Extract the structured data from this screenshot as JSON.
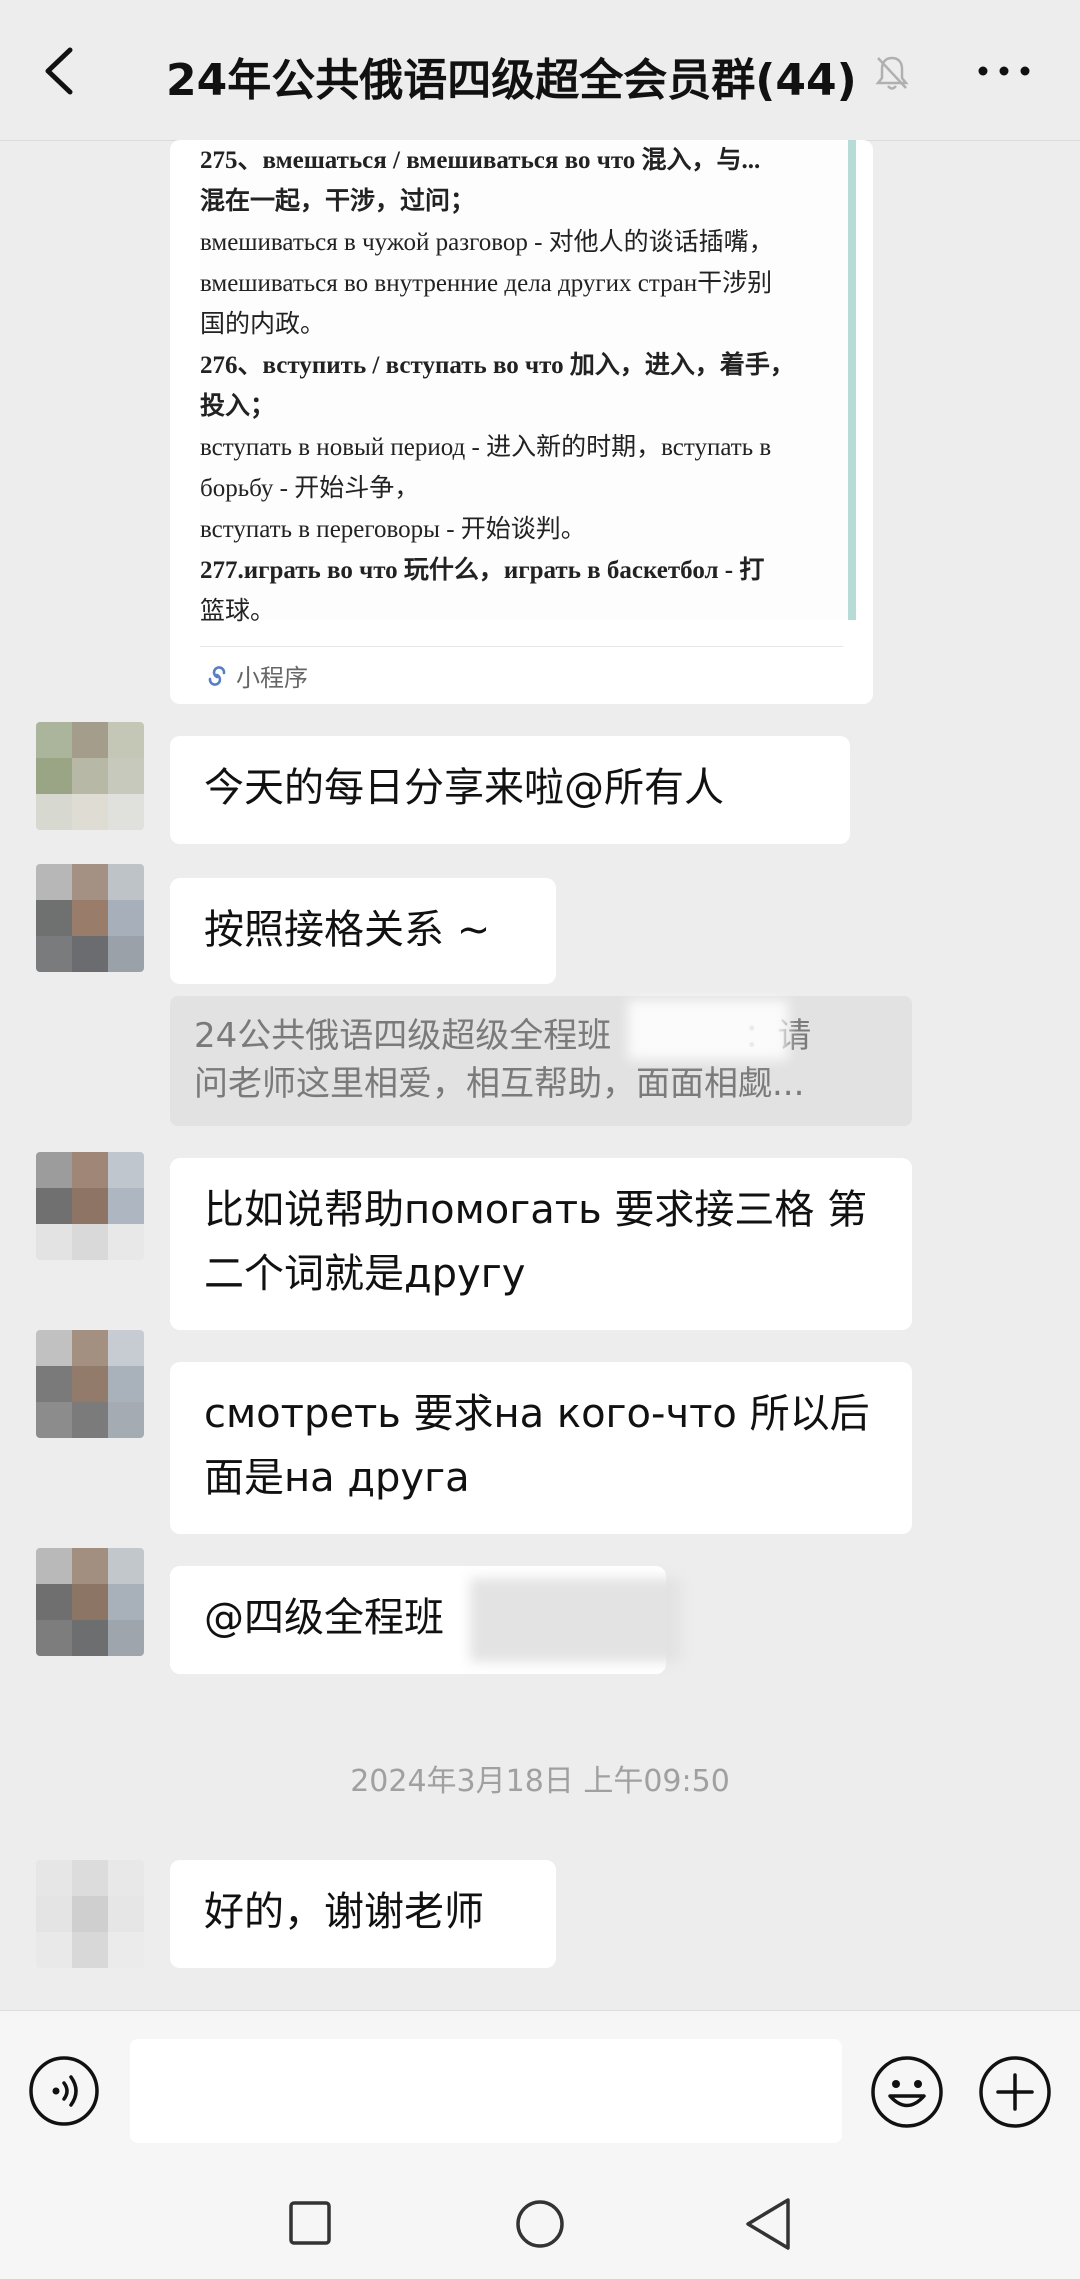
{
  "header": {
    "title": "24年公共俄语四级超全会员群(44)",
    "back_icon": "back-arrow-icon",
    "mute_icon": "bell-muted-icon",
    "more_icon": "more-dots-icon"
  },
  "card": {
    "lines": [
      {
        "text": "275、вмешаться / вмешиваться во что 混入，与...",
        "bold": true
      },
      {
        "text": "混在一起，干涉，过问；",
        "bold": true
      },
      {
        "text": "вмешиваться в чужой разговор - 对他人的谈话插嘴，",
        "bold": false
      },
      {
        "text": "вмешиваться во внутренние дела других стран干涉别",
        "bold": false
      },
      {
        "text": "国的内政。",
        "bold": false
      },
      {
        "text": "276、вступить / вступать во что 加入，进入，着手，",
        "bold": true
      },
      {
        "text": "投入；",
        "bold": true
      },
      {
        "text": "вступать в новый период - 进入新的时期，вступать в",
        "bold": false
      },
      {
        "text": "борьбу - 开始斗争，",
        "bold": false
      },
      {
        "text": "вступать в переговоры - 开始谈判。",
        "bold": false
      },
      {
        "text": "277.играть во что 玩什么，играть в баскетбол - 打",
        "bold": true
      },
      {
        "text": "篮球。",
        "bold": false
      }
    ],
    "mini_label": "小程序"
  },
  "messages": [
    {
      "text": "今天的每日分享来啦@所有人"
    },
    {
      "text": "按照接格关系 ~"
    },
    {
      "text": "比如说帮助помогать 要求接三格 第二个词就是другу"
    },
    {
      "text": "смотреть 要求на кого-что 所以后面是на друга"
    },
    {
      "text": "@四级全程班"
    },
    {
      "text": "好的，谢谢老师"
    }
  ],
  "quote": {
    "line1": "24公共俄语四级超级全程班",
    "line1_tail": "：请",
    "line2": "问老师这里相爱，相互帮助，面面相觑..."
  },
  "timestamp": "2024年3月18日 上午09:50",
  "inputbar": {
    "voice_icon": "voice-icon",
    "emoji_icon": "emoji-icon",
    "plus_icon": "plus-icon"
  },
  "navbar": {
    "recent_icon": "square-nav-icon",
    "home_icon": "circle-nav-icon",
    "back_icon": "triangle-nav-icon"
  }
}
